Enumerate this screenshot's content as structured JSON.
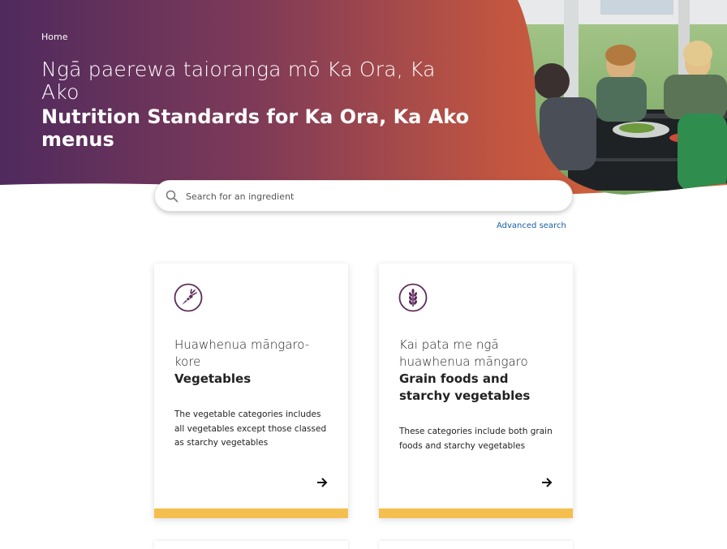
{
  "colors": {
    "gradient_start": "#4f2a5e",
    "gradient_end": "#d9653a",
    "accent_bar": "#f5bf4f",
    "icon_purple": "#5c2b5c",
    "link_blue": "#1a5ea8"
  },
  "breadcrumb": {
    "home_label": "Home"
  },
  "hero": {
    "title_mi": "Ngā paerewa taioranga mō Ka Ora, Ka Ako",
    "title_en": "Nutrition Standards for Ka Ora, Ka Ako menus"
  },
  "search": {
    "placeholder": "Search for an ingredient",
    "value": "",
    "icon": "search-icon",
    "advanced_label": "Advanced search"
  },
  "cards": [
    {
      "icon": "carrot-icon",
      "title_mi": "Huawhenua māngaro-kore",
      "title_en": "Vegetables",
      "description": "The vegetable categories includes all vegetables except those classed as starchy vegetables",
      "arrow_icon": "arrow-right-icon"
    },
    {
      "icon": "wheat-icon",
      "title_mi": "Kai pata me ngā huawhenua māngaro",
      "title_en": "Grain foods and starchy vegetables",
      "description": "These categories include both grain foods and starchy vegetables",
      "arrow_icon": "arrow-right-icon"
    }
  ]
}
